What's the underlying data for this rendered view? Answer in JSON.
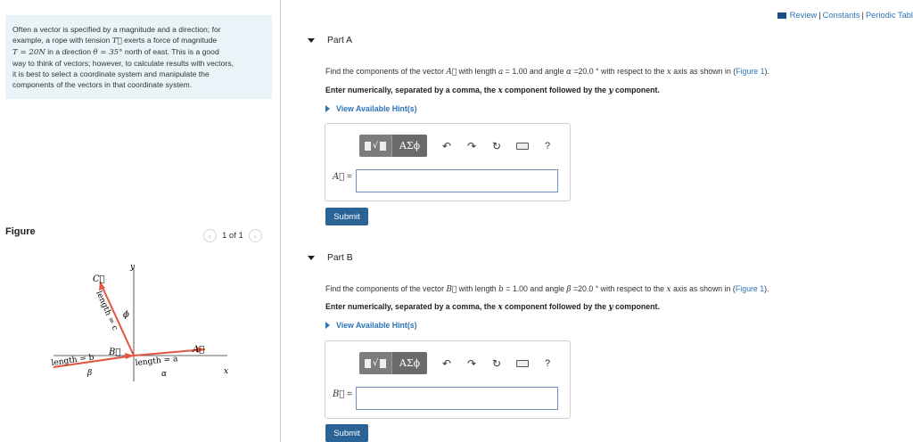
{
  "intro": {
    "line1": "Often a vector is specified by a magnitude and a direction; for",
    "line2_a": "example, a rope with tension ",
    "line2_var": "T⃗",
    "line2_b": " exerts a force of magnitude",
    "line3_var1": "T = 20N",
    "line3_a": " in a direction ",
    "line3_var2": "θ = 35°",
    "line3_b": " north of east. This is a good",
    "line4": "way to think of vectors; however, to calculate results with vectors,",
    "line5": "it is best to select a coordinate system and manipulate the",
    "line6": "components of the vectors in that coordinate system."
  },
  "figure": {
    "title": "Figure",
    "pager_text": "1 of 1",
    "prev_icon": "chevron-left-icon",
    "next_icon": "chevron-right-icon",
    "labels": {
      "y_axis": "y",
      "x_axis": "x",
      "vec_c": "C⃗",
      "vec_b": "B⃗",
      "vec_a": "A⃗",
      "len_c": "length = c",
      "len_b": "length = b",
      "len_a": "length = a",
      "phi": "ϕ",
      "beta": "β",
      "alpha": "α"
    }
  },
  "topbar": {
    "review": "Review",
    "sep1": "|",
    "constants": "Constants",
    "sep2": "|",
    "periodic": "Periodic Tabl",
    "book_icon": "book-icon"
  },
  "parts": {
    "a": {
      "title": "Part A",
      "q_a": "Find the components of the vector ",
      "q_vec": "A⃗",
      "q_b": " with length ",
      "q_var": "a",
      "q_c": " = 1.00 and angle ",
      "q_ang": "α",
      "q_d": " =20.0 ° with respect to the ",
      "q_x": "x",
      "q_e": " axis as shown in (",
      "q_link": "Figure 1",
      "q_f": ").",
      "instr_a": "Enter numerically, separated by a comma, the ",
      "instr_x": "x",
      "instr_b": " component followed by the ",
      "instr_y": "y",
      "instr_c": " component.",
      "hint": "View Available Hint(s)",
      "label": "A⃗",
      "eq": " =",
      "submit": "Submit",
      "input_value": ""
    },
    "b": {
      "title": "Part B",
      "q_a": "Find the components of the vector ",
      "q_vec": "B⃗",
      "q_b": " with length ",
      "q_var": "b",
      "q_c": " = 1.00 and angle ",
      "q_ang": "β",
      "q_d": " =20.0 ° with respect to the ",
      "q_x": "x",
      "q_e": " axis as shown in (",
      "q_link": "Figure 1",
      "q_f": ").",
      "instr_a": "Enter numerically, separated by a comma, the ",
      "instr_x": "x",
      "instr_b": " component followed by the ",
      "instr_y": "y",
      "instr_c": " component.",
      "hint": "View Available Hint(s)",
      "label": "B⃗",
      "eq": " =",
      "submit": "Submit",
      "input_value": ""
    }
  },
  "toolbar": {
    "greek": "ΑΣϕ",
    "undo": "↶",
    "redo": "↷",
    "reset": "↻",
    "help": "?",
    "icons": [
      "templates-icon",
      "greek-symbols-icon",
      "undo-icon",
      "redo-icon",
      "reset-icon",
      "keyboard-icon",
      "help-icon"
    ]
  }
}
